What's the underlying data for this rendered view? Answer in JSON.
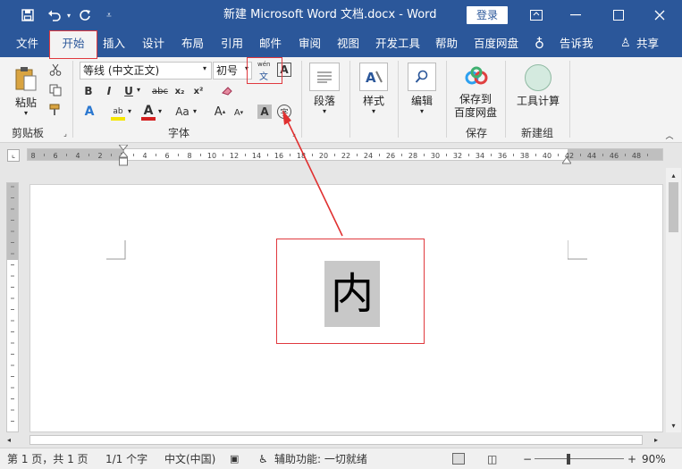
{
  "title_bar": {
    "doc_title": "新建 Microsoft Word 文档.docx  -  Word",
    "login": "登录"
  },
  "tabs": [
    "文件",
    "开始",
    "插入",
    "设计",
    "布局",
    "引用",
    "邮件",
    "审阅",
    "视图",
    "开发工具",
    "帮助",
    "百度网盘"
  ],
  "tell_me": "告诉我",
  "share": "共享",
  "ribbon": {
    "clipboard": {
      "paste": "粘贴",
      "label": "剪贴板"
    },
    "font": {
      "font_name": "等线 (中文正文)",
      "font_size": "初号",
      "label": "字体",
      "phonetic_top": "wén",
      "phonetic_bottom": "文",
      "bold": "B",
      "italic": "I",
      "underline": "U",
      "strike": "abc",
      "subscript": "x₂",
      "superscript": "x²",
      "grow": "A",
      "shrink": "A",
      "case": "Aa",
      "char_border": "A",
      "char_shade": "A",
      "enclose": "字"
    },
    "paragraph": {
      "label": "段落"
    },
    "styles": {
      "label": "样式"
    },
    "editing": {
      "label": "编辑"
    },
    "save": {
      "button": "保存到\n百度网盘",
      "label": "保存"
    },
    "newgroup": {
      "button": "工具计算",
      "label": "新建组"
    }
  },
  "ruler_ticks": [
    "8",
    "6",
    "4",
    "2",
    "2",
    "4",
    "6",
    "8",
    "10",
    "12",
    "14",
    "16",
    "18",
    "20",
    "22",
    "24",
    "26",
    "28",
    "30",
    "32",
    "34",
    "36",
    "38",
    "40",
    "42",
    "44",
    "46",
    "48"
  ],
  "document": {
    "char": "内"
  },
  "status": {
    "page": "第 1 页，共 1 页",
    "words": "1/1 个字",
    "lang": "中文(中国)",
    "accessibility": "辅助功能: 一切就绪",
    "zoom": "90%"
  },
  "colors": {
    "brand": "#2b579a",
    "highlight_box": "#e0393e",
    "char_shade": "#c8c8c8"
  }
}
